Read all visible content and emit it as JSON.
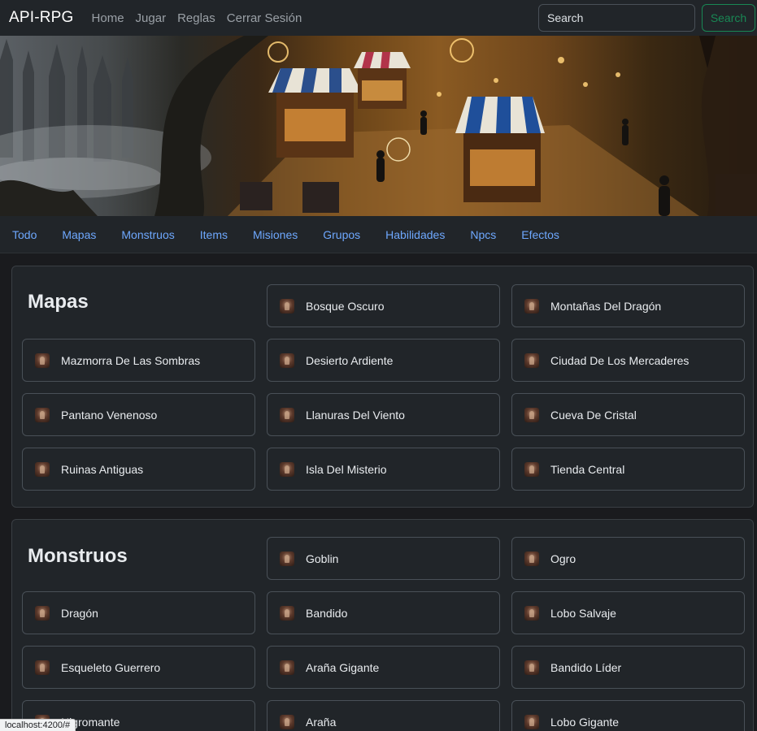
{
  "navbar": {
    "brand": "API-RPG",
    "links": [
      "Home",
      "Jugar",
      "Reglas",
      "Cerrar Sesión"
    ],
    "search_placeholder": "Search",
    "search_button": "Search"
  },
  "tabs": [
    "Todo",
    "Mapas",
    "Monstruos",
    "Items",
    "Misiones",
    "Grupos",
    "Habilidades",
    "Npcs",
    "Efectos"
  ],
  "sections": [
    {
      "title": "Mapas",
      "items": [
        "Bosque Oscuro",
        "Montañas Del Dragón",
        "Mazmorra De Las Sombras",
        "Desierto Ardiente",
        "Ciudad De Los Mercaderes",
        "Pantano Venenoso",
        "Llanuras Del Viento",
        "Cueva De Cristal",
        "Ruinas Antiguas",
        "Isla Del Misterio",
        "Tienda Central"
      ]
    },
    {
      "title": "Monstruos",
      "items": [
        "Goblin",
        "Ogro",
        "Dragón",
        "Bandido",
        "Lobo Salvaje",
        "Esqueleto Guerrero",
        "Araña Gigante",
        "Bandido Líder",
        "Nigromante",
        "Araña",
        "Lobo Gigante"
      ]
    }
  ],
  "status_bar": "localhost:4200/#",
  "colors": {
    "background": "#1a1b1e",
    "panel": "#212529",
    "tab_link": "#6ea8fe",
    "search_button": "#198754"
  }
}
